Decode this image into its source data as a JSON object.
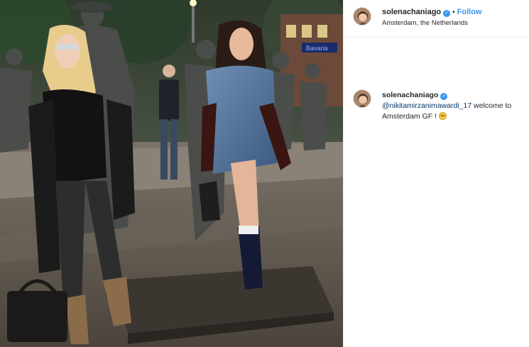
{
  "post": {
    "photo_alt": "Photo",
    "author": {
      "username": "solenachaniago",
      "verified_icon": "verified-badge-icon",
      "separator": "•",
      "follow_label": "Follow",
      "location": "Amsterdam, the Netherlands"
    },
    "caption": {
      "username": "solenachaniago",
      "verified_icon": "verified-badge-icon",
      "mention": "@nikitamirzanimawardi_17",
      "text": " welcome to Amsterdam GF ! ",
      "emoji_icon": "smiling-face-icon"
    },
    "sign_text": "Bavaria"
  },
  "colors": {
    "accent": "#3897f0",
    "mention": "#003569",
    "text": "#262626",
    "border": "#efefef"
  }
}
